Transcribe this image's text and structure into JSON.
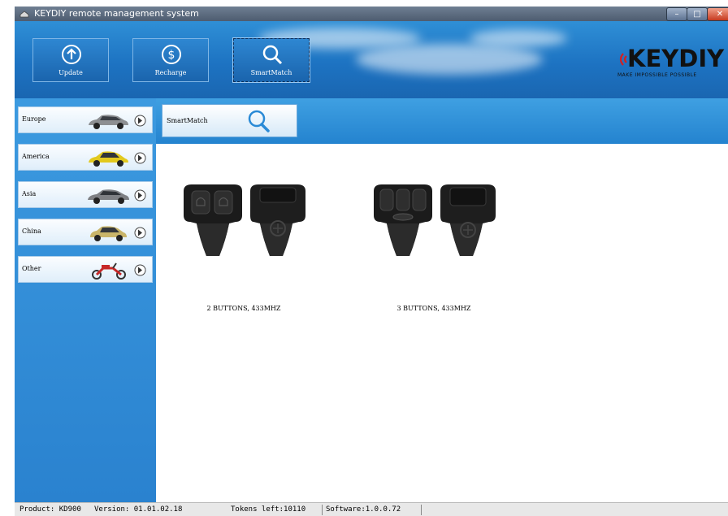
{
  "window": {
    "title": "KEYDIY remote management system",
    "controls": {
      "minimize": "–",
      "maximize": "□",
      "close": "✕"
    }
  },
  "toolbar": {
    "buttons": [
      {
        "label": "Update",
        "icon": "upload-arrow-icon"
      },
      {
        "label": "Recharge",
        "icon": "dollar-coin-icon"
      },
      {
        "label": "SmartMatch",
        "icon": "magnifier-icon",
        "active": true
      }
    ]
  },
  "logo": {
    "text": "KEYDIY",
    "slogan": "MAKE IMPOSSIBLE POSSIBLE"
  },
  "sidebar": {
    "items": [
      {
        "label": "Europe",
        "icon": "sedan-car-icon"
      },
      {
        "label": "America",
        "icon": "hatchback-car-icon"
      },
      {
        "label": "Asia",
        "icon": "sedan-car-icon"
      },
      {
        "label": "China",
        "icon": "compact-car-icon"
      },
      {
        "label": "Other",
        "icon": "scooter-icon"
      }
    ]
  },
  "search": {
    "label": "SmartMatch",
    "icon": "magnifier-icon"
  },
  "products": [
    {
      "label": "2 BUTTONS, 433MHZ",
      "buttons": 2
    },
    {
      "label": "3 BUTTONS, 433MHZ",
      "buttons": 3
    }
  ],
  "status": {
    "product": "Product: KD900",
    "version": "Version: 01.01.02.18",
    "tokens": "Tokens left:10110",
    "software": "Software:1.0.0.72"
  },
  "colors": {
    "header_blue": "#1d73c2",
    "sidebar_blue": "#2a82cf",
    "logo_red": "#d42020"
  }
}
